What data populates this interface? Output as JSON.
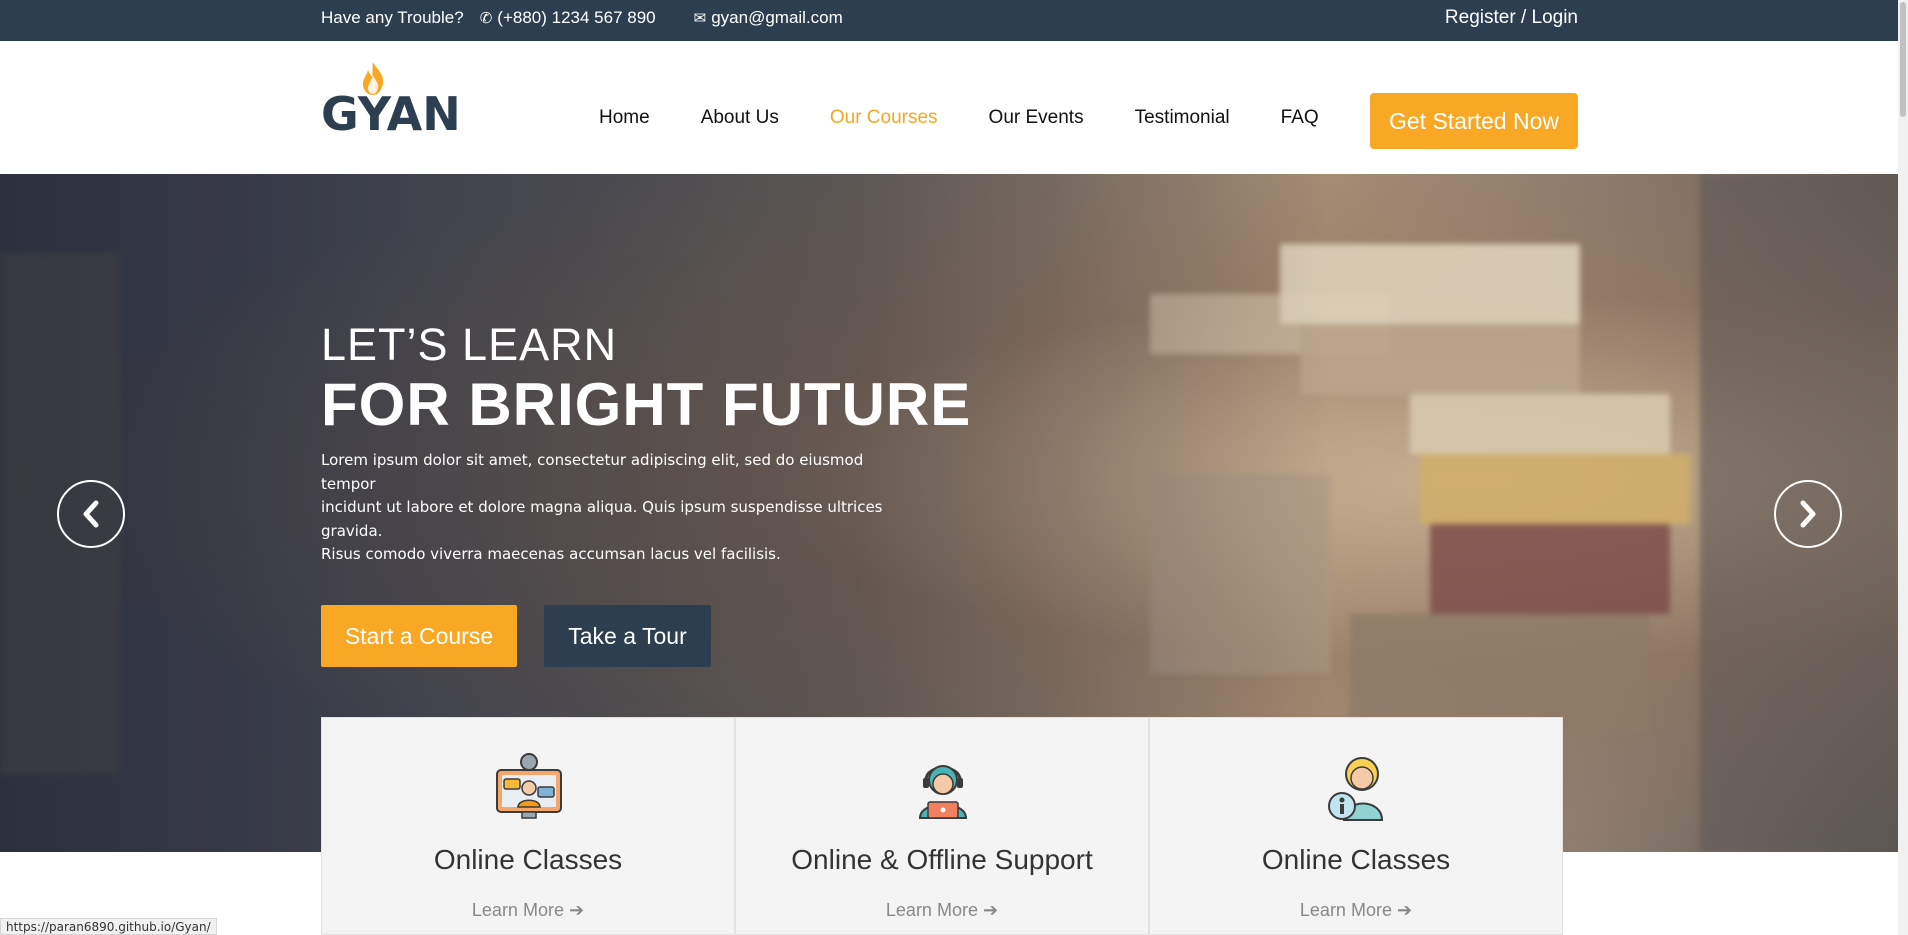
{
  "topbar": {
    "trouble_text": "Have any Trouble?",
    "phone": "(+880) 1234 567 890",
    "email": "gyan@gmail.com",
    "auth_link": "Register / Login"
  },
  "header": {
    "logo_text": "GYAN",
    "nav": [
      {
        "label": "Home"
      },
      {
        "label": "About Us"
      },
      {
        "label": "Our Courses",
        "active": true
      },
      {
        "label": "Our Events"
      },
      {
        "label": "Testimonial"
      },
      {
        "label": "FAQ"
      }
    ],
    "cta_label": "Get Started Now"
  },
  "hero": {
    "subtitle": "LET’S LEARN",
    "title": "FOR BRIGHT FUTURE",
    "text_lines": [
      "Lorem ipsum dolor sit amet, consectetur adipiscing elit, sed do eiusmod tempor",
      "incidunt ut labore et dolore magna aliqua. Quis ipsum suspendisse ultrices gravida.",
      "Risus comodo viverra maecenas accumsan lacus vel facilisis."
    ],
    "start_button": "Start a Course",
    "tour_button": "Take a Tour"
  },
  "features": [
    {
      "title": "Online Classes",
      "link": "Learn More",
      "icon": "online-class-icon"
    },
    {
      "title": "Online & Offline Support",
      "link": "Learn More",
      "icon": "support-agent-icon"
    },
    {
      "title": "Online Classes",
      "link": "Learn More",
      "icon": "info-person-icon"
    }
  ],
  "status_url": "https://paran6890.github.io/Gyan/",
  "colors": {
    "topbar": "#2c3e50",
    "accent": "#f9a825",
    "dark_button": "#2c3e50"
  }
}
